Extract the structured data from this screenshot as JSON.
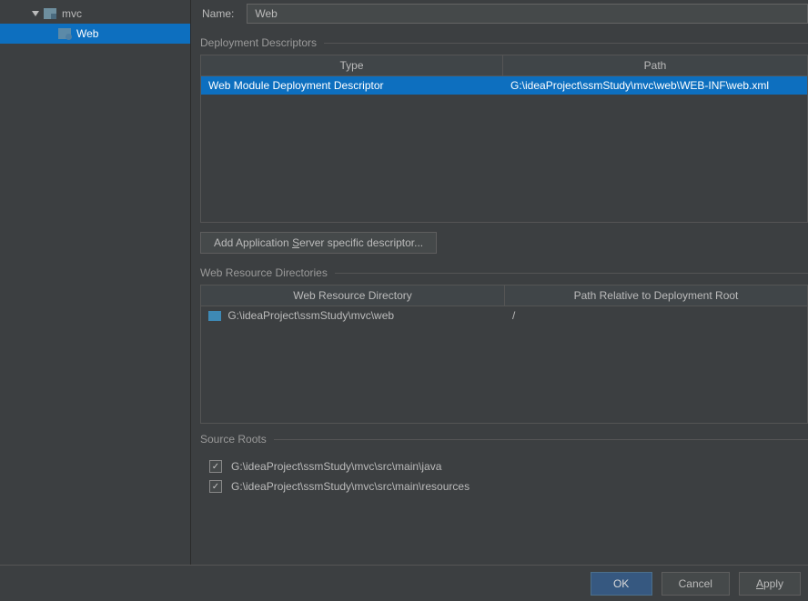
{
  "sidebar": {
    "mvc_label": "mvc",
    "web_label": "Web"
  },
  "form": {
    "name_label": "Name:",
    "name_value": "Web"
  },
  "deploy_descriptors": {
    "title": "Deployment Descriptors",
    "col_type": "Type",
    "col_path": "Path",
    "rows": [
      {
        "type": "Web Module Deployment Descriptor",
        "path": "G:\\ideaProject\\ssmStudy\\mvc\\web\\WEB-INF\\web.xml"
      }
    ],
    "add_btn": "Add Application Server specific descriptor..."
  },
  "web_resource": {
    "title": "Web Resource Directories",
    "col_dir": "Web Resource Directory",
    "col_rel": "Path Relative to Deployment Root",
    "rows": [
      {
        "dir": "G:\\ideaProject\\ssmStudy\\mvc\\web",
        "rel": "/"
      }
    ]
  },
  "source_roots": {
    "title": "Source Roots",
    "items": [
      "G:\\ideaProject\\ssmStudy\\mvc\\src\\main\\java",
      "G:\\ideaProject\\ssmStudy\\mvc\\src\\main\\resources"
    ]
  },
  "buttons": {
    "ok": "OK",
    "cancel": "Cancel",
    "apply": "Apply"
  }
}
